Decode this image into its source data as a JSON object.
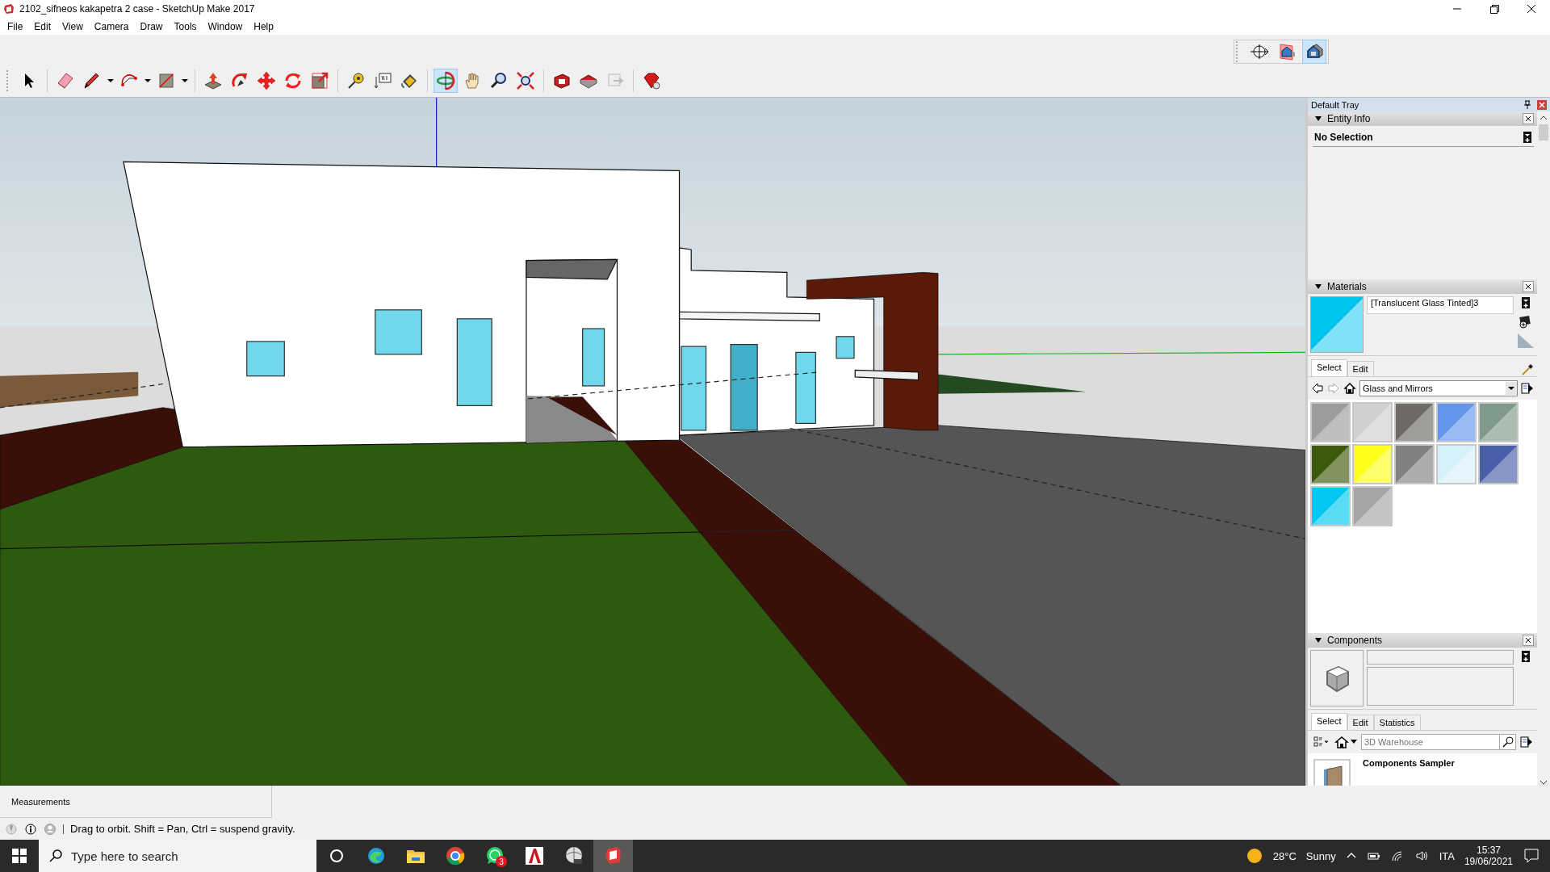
{
  "window": {
    "title": "2102_sifneos kakapetra 2 case - SketchUp Make 2017"
  },
  "menu": [
    "File",
    "Edit",
    "View",
    "Camera",
    "Draw",
    "Tools",
    "Window",
    "Help"
  ],
  "views_toolbar": [
    {
      "kind": "position-camera",
      "selected": false
    },
    {
      "kind": "section-house",
      "selected": false
    },
    {
      "kind": "house",
      "selected": true
    }
  ],
  "toolbar": [
    [
      {
        "kind": "select",
        "selected": false
      }
    ],
    [
      {
        "kind": "eraser",
        "selected": false
      },
      {
        "kind": "pencil",
        "selected": false
      },
      {
        "kind": "caret",
        "selected": false
      },
      {
        "kind": "arc",
        "selected": false
      },
      {
        "kind": "caret",
        "selected": false
      },
      {
        "kind": "rectangle",
        "selected": false
      },
      {
        "kind": "caret",
        "selected": false
      }
    ],
    [
      {
        "kind": "push-pull",
        "selected": false
      },
      {
        "kind": "follow-me",
        "selected": false
      },
      {
        "kind": "move",
        "selected": false
      },
      {
        "kind": "rotate",
        "selected": false
      },
      {
        "kind": "scale",
        "selected": false
      }
    ],
    [
      {
        "kind": "tape",
        "selected": false
      },
      {
        "kind": "text",
        "selected": false
      },
      {
        "kind": "paint",
        "selected": false
      }
    ],
    [
      {
        "kind": "orbit",
        "selected": true
      },
      {
        "kind": "pan",
        "selected": false
      },
      {
        "kind": "zoom",
        "selected": false
      },
      {
        "kind": "zoom-extents",
        "selected": false
      }
    ],
    [
      {
        "kind": "warehouse",
        "selected": false
      },
      {
        "kind": "extension",
        "selected": false
      },
      {
        "kind": "layout",
        "selected": false
      }
    ],
    [
      {
        "kind": "ruby",
        "selected": false
      }
    ]
  ],
  "tray": {
    "title": "Default Tray",
    "entity_info": {
      "title": "Entity Info",
      "expanded": true,
      "text": "No Selection"
    },
    "materials": {
      "title": "Materials",
      "expanded": true,
      "name": "[Translucent Glass Tinted]3",
      "tabs": [
        {
          "label": "Select",
          "selected": true
        },
        {
          "label": "Edit",
          "selected": false
        }
      ],
      "library": "Glass and Mirrors",
      "swatches": [
        {
          "color": "#9c9c9c"
        },
        {
          "color": "#d0d0d0"
        },
        {
          "color": "#6e6a66"
        },
        {
          "color": "#6495ed"
        },
        {
          "color": "#7f9a8a"
        },
        {
          "color": "#3d5a0a"
        },
        {
          "color": "#ffff1a"
        },
        {
          "color": "#808080"
        },
        {
          "color": "#d6f0fa"
        },
        {
          "color": "#4a5ea8"
        },
        {
          "color": "#00c8f0"
        },
        {
          "color": "#a5a5a5"
        }
      ]
    },
    "components": {
      "title": "Components",
      "expanded": true,
      "tabs": [
        {
          "label": "Select",
          "selected": true
        },
        {
          "label": "Edit",
          "selected": false
        },
        {
          "label": "Statistics",
          "selected": false
        }
      ],
      "search": {
        "placeholder": "3D Warehouse"
      },
      "items": [
        {
          "name": "Components Sampler"
        }
      ]
    }
  },
  "measurements": {
    "label": "Measurements"
  },
  "status": {
    "text": "Drag to orbit. Shift = Pan, Ctrl = suspend gravity."
  },
  "taskbar": {
    "search": {
      "placeholder": "Type here to search"
    },
    "apps": [
      {
        "kind": "cortana",
        "selected": false
      },
      {
        "kind": "edge",
        "selected": false
      },
      {
        "kind": "explorer",
        "selected": false
      },
      {
        "kind": "chrome",
        "selected": false
      },
      {
        "kind": "whatsapp",
        "selected": false,
        "badge": "3"
      },
      {
        "kind": "autocad",
        "selected": false
      },
      {
        "kind": "earth",
        "selected": false
      },
      {
        "kind": "sketchup",
        "selected": true
      }
    ],
    "temperature": "28°C",
    "weather": "Sunny",
    "language": "ITA",
    "time": "15:37",
    "date": "19/06/2021"
  }
}
